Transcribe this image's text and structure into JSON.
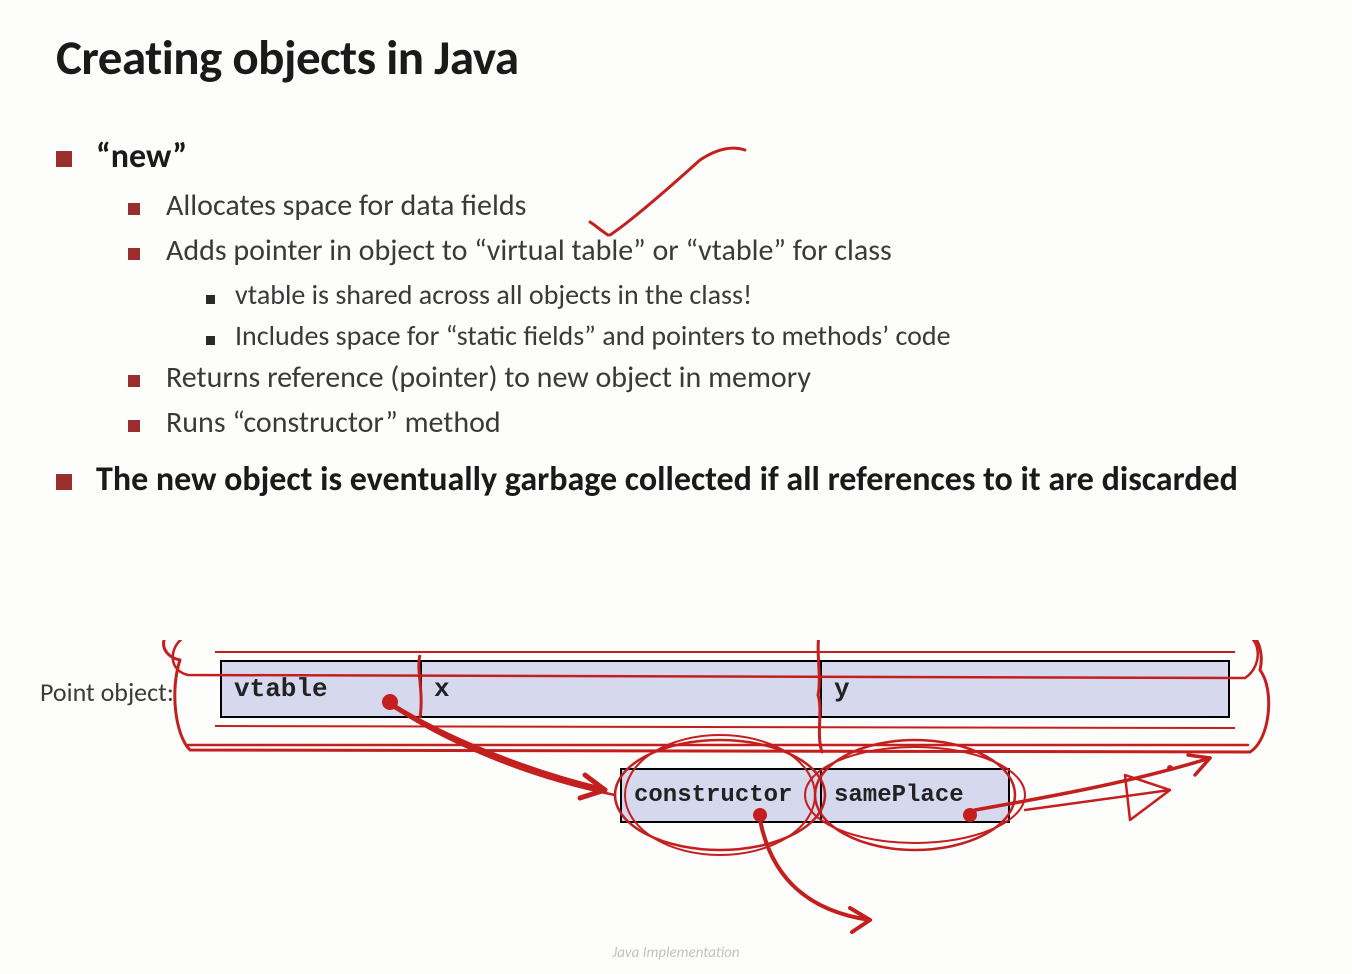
{
  "title": "Creating objects in Java",
  "bullets": {
    "b1": "“new”",
    "b1_1": "Allocates space for data fields",
    "b1_2": "Adds pointer in object to “virtual table” or “vtable” for class",
    "b1_2_1": "vtable is shared across all objects in the class!",
    "b1_2_2": "Includes space for “static fields” and pointers to methods’ code",
    "b1_3": "Returns reference (pointer) to new object in memory",
    "b1_4": "Runs “constructor” method",
    "b2": "The new object is eventually garbage collected if all references to it are discarded"
  },
  "diagram": {
    "object_label": "Point object:",
    "cells": {
      "vtable": "vtable",
      "x": "x",
      "y": "y",
      "constructor": "constructor",
      "samePlace": "samePlace"
    }
  },
  "footer": "Java Implementation"
}
